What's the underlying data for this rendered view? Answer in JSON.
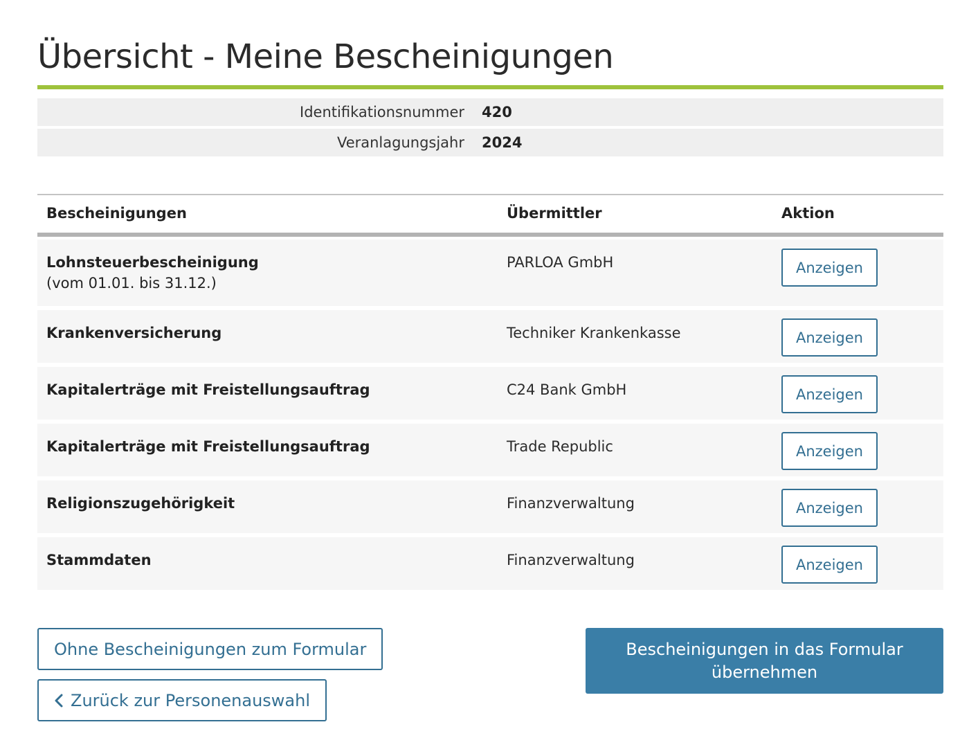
{
  "page": {
    "title": "Übersicht - Meine Bescheinigungen"
  },
  "info": [
    {
      "label": "Identifikationsnummer",
      "value": "420"
    },
    {
      "label": "Veranlagungsjahr",
      "value": "2024"
    }
  ],
  "table": {
    "headers": {
      "certificates": "Bescheinigungen",
      "sender": "Übermittler",
      "action": "Aktion"
    },
    "rows": [
      {
        "name": "Lohnsteuerbescheinigung",
        "sub": "(vom 01.01. bis 31.12.)",
        "sender": "PARLOA GmbH",
        "action": "Anzeigen"
      },
      {
        "name": "Krankenversicherung",
        "sender": "Techniker Krankenkasse",
        "action": "Anzeigen"
      },
      {
        "name": "Kapitalerträge mit Freistellungsauftrag",
        "sender": "C24 Bank GmbH",
        "action": "Anzeigen"
      },
      {
        "name": "Kapitalerträge mit Freistellungsauftrag",
        "sender": "Trade Republic",
        "action": "Anzeigen"
      },
      {
        "name": "Religionszugehörigkeit",
        "sender": "Finanzverwaltung",
        "action": "Anzeigen"
      },
      {
        "name": "Stammdaten",
        "sender": "Finanzverwaltung",
        "action": "Anzeigen"
      }
    ]
  },
  "actions": {
    "without_certificates": "Ohne Bescheinigungen zum Formular",
    "back": "Zurück zur Personenauswahl",
    "apply": "Bescheinigungen in das Formular übernehmen"
  },
  "colors": {
    "accent_rule": "#9ec23c",
    "primary": "#3a7ea7",
    "outline": "#336f92"
  },
  "icons": {
    "back": "chevron-left-icon"
  }
}
